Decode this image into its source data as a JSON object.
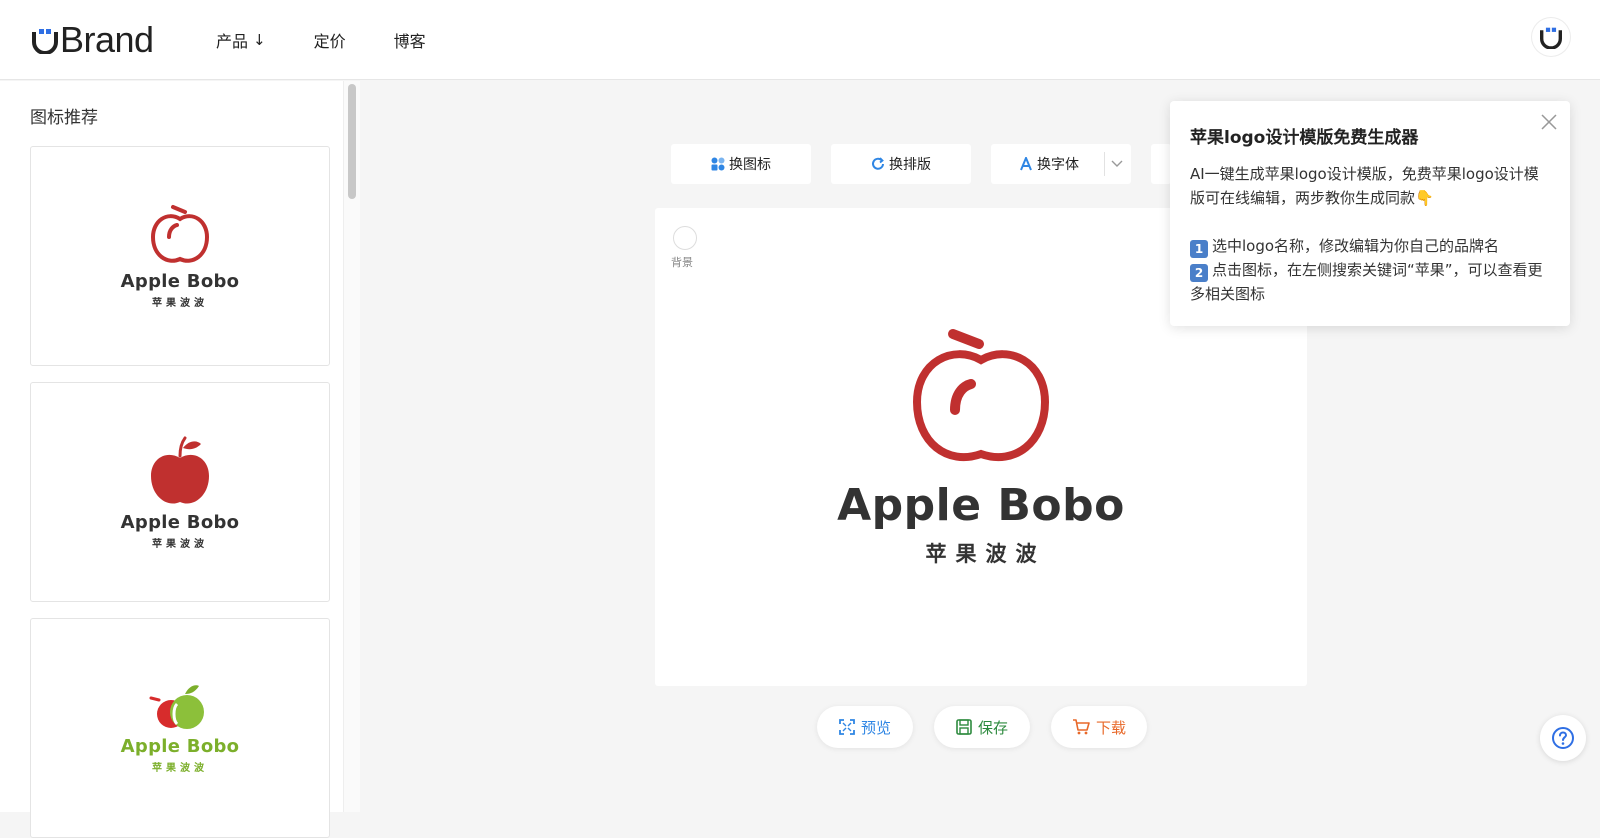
{
  "brand": {
    "name": "Brand"
  },
  "nav": {
    "products": "产品",
    "pricing": "定价",
    "blog": "博客"
  },
  "sidebar": {
    "title": "图标推荐",
    "cards": [
      {
        "name": "Apple Bobo",
        "sub": "苹果波波",
        "color": "#333333",
        "icon": "apple-outline-icon"
      },
      {
        "name": "Apple Bobo",
        "sub": "苹果波波",
        "color": "#333333",
        "icon": "apple-solid-icon"
      },
      {
        "name": "Apple Bobo",
        "sub": "苹果波波",
        "color": "#7caf2b",
        "icon": "apple-green-red-icon"
      }
    ]
  },
  "toolbar": {
    "change_icon": "换图标",
    "change_layout": "换排版",
    "change_font": "换字体"
  },
  "canvas": {
    "bg_label": "背景",
    "logo_name": "Apple Bobo",
    "logo_sub": "苹果波波",
    "accent": "#c0302f"
  },
  "actions": {
    "preview": "预览",
    "save": "保存",
    "download": "下载"
  },
  "popup": {
    "title": "苹果logo设计模版免费生成器",
    "line1": "AI一键生成苹果logo设计模版，免费苹果logo设计模版可在线编辑，两步教你生成同款👇",
    "step1": "选中logo名称，修改编辑为你自己的品牌名",
    "step2": "点击图标，在左侧搜索关键词“苹果”，可以查看更多相关图标",
    "step1_num": "1",
    "step2_num": "2"
  }
}
